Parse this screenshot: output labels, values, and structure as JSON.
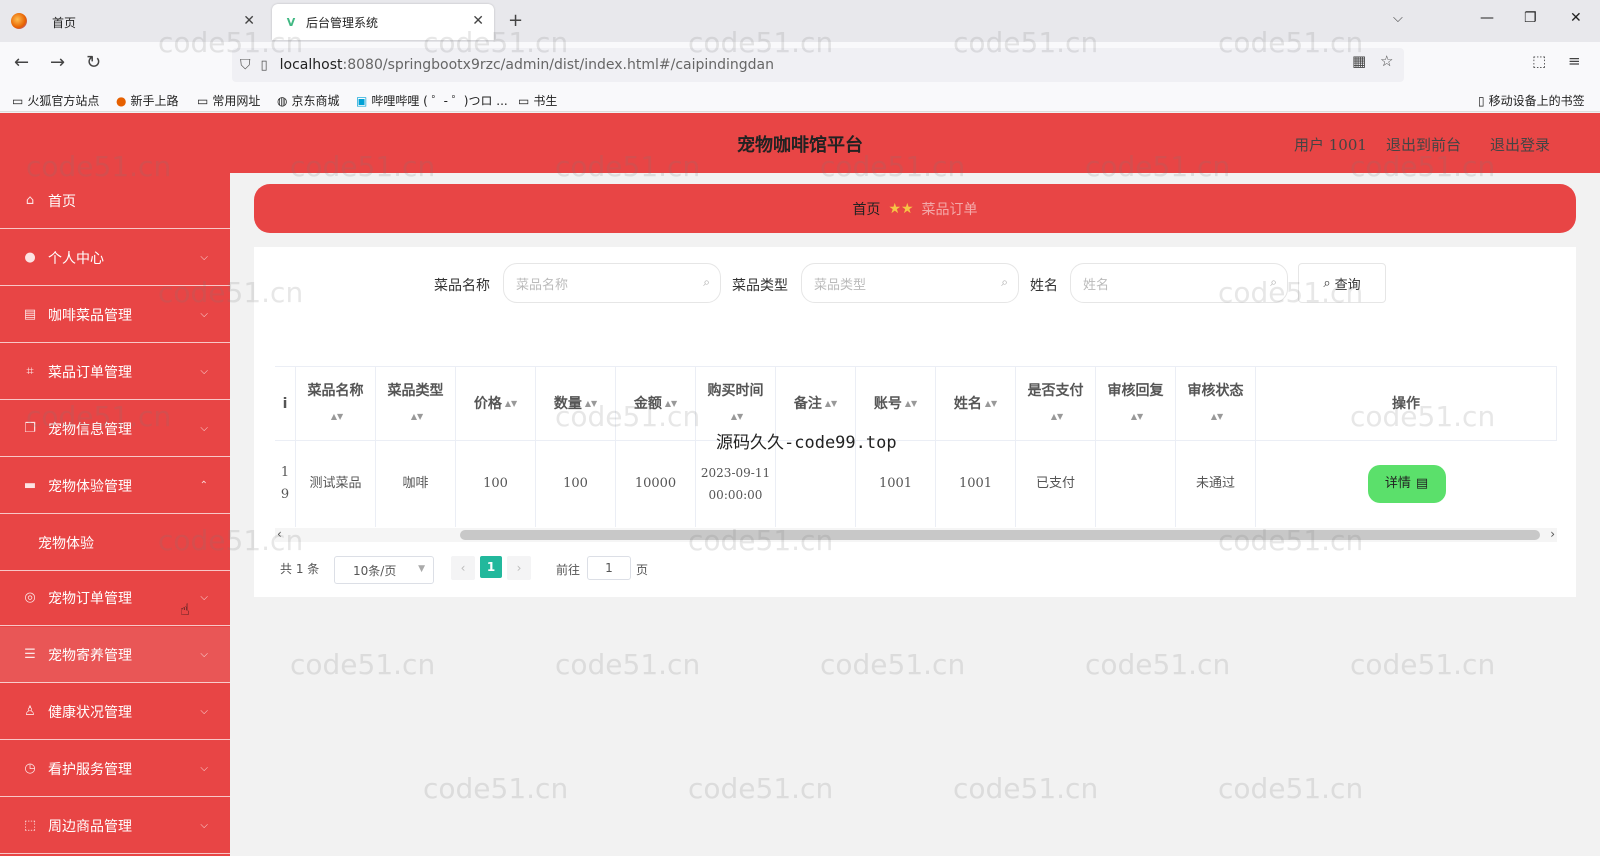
{
  "browser": {
    "tabs": [
      {
        "label": "首页",
        "active": false
      },
      {
        "label": "后台管理系统",
        "active": true
      }
    ],
    "url_host": "localhost",
    "url_rest": ":8080/springbootx9rzc/admin/dist/index.html#/caipindingdan",
    "bookmarks": [
      "火狐官方站点",
      "新手上路",
      "常用网址",
      "京东商城",
      "哔哩哔哩 ( ゜- ゜)つロ ...",
      "书生"
    ],
    "mobile_bookmarks": "移动设备上的书签"
  },
  "header": {
    "title": "宠物咖啡馆平台",
    "user": "用户 1001",
    "to_front": "退出到前台",
    "logout": "退出登录"
  },
  "sidebar": {
    "items": [
      {
        "label": "首页",
        "icon": "home-icon"
      },
      {
        "label": "个人中心",
        "icon": "user-icon"
      },
      {
        "label": "咖啡菜品管理",
        "icon": "document-icon"
      },
      {
        "label": "菜品订单管理",
        "icon": "crop-icon"
      },
      {
        "label": "宠物信息管理",
        "icon": "copy-icon"
      },
      {
        "label": "宠物体验管理",
        "icon": "briefcase-icon"
      },
      {
        "label": "宠物体验",
        "icon": ""
      },
      {
        "label": "宠物订单管理",
        "icon": "target-icon"
      },
      {
        "label": "宠物寄养管理",
        "icon": "list-icon"
      },
      {
        "label": "健康状况管理",
        "icon": "mic-icon"
      },
      {
        "label": "看护服务管理",
        "icon": "compass-icon"
      },
      {
        "label": "周边商品管理",
        "icon": "frame-icon"
      }
    ]
  },
  "breadcrumb": {
    "home": "首页",
    "current": "菜品订单"
  },
  "search": {
    "name_label": "菜品名称",
    "name_placeholder": "菜品名称",
    "type_label": "菜品类型",
    "type_placeholder": "菜品类型",
    "person_label": "姓名",
    "person_placeholder": "姓名",
    "button": "查询"
  },
  "table": {
    "headers": [
      "菜品名称",
      "菜品类型",
      "价格",
      "数量",
      "金额",
      "购买时间",
      "备注",
      "账号",
      "姓名",
      "是否支付",
      "审核回复",
      "审核状态",
      "操作"
    ],
    "partial_header": "i",
    "row": {
      "partial": "1\n9",
      "name": "测试菜品",
      "type": "咖啡",
      "price": "100",
      "qty": "100",
      "amount": "10000",
      "time": "2023-09-11 00:00:00",
      "note": "",
      "account": "1001",
      "person": "1001",
      "paid": "已支付",
      "reply": "",
      "status": "未通过",
      "action": "详情"
    }
  },
  "pager": {
    "total": "共 1 条",
    "size": "10条/页",
    "page": "1",
    "goto": "前往",
    "goto_value": "1",
    "page_suffix": "页"
  },
  "watermark": "源码久久-code99.top",
  "bg_watermark": "code51.cn",
  "colors": {
    "primary": "#e84545",
    "success": "#5be06b",
    "page_active": "#22b89c"
  }
}
